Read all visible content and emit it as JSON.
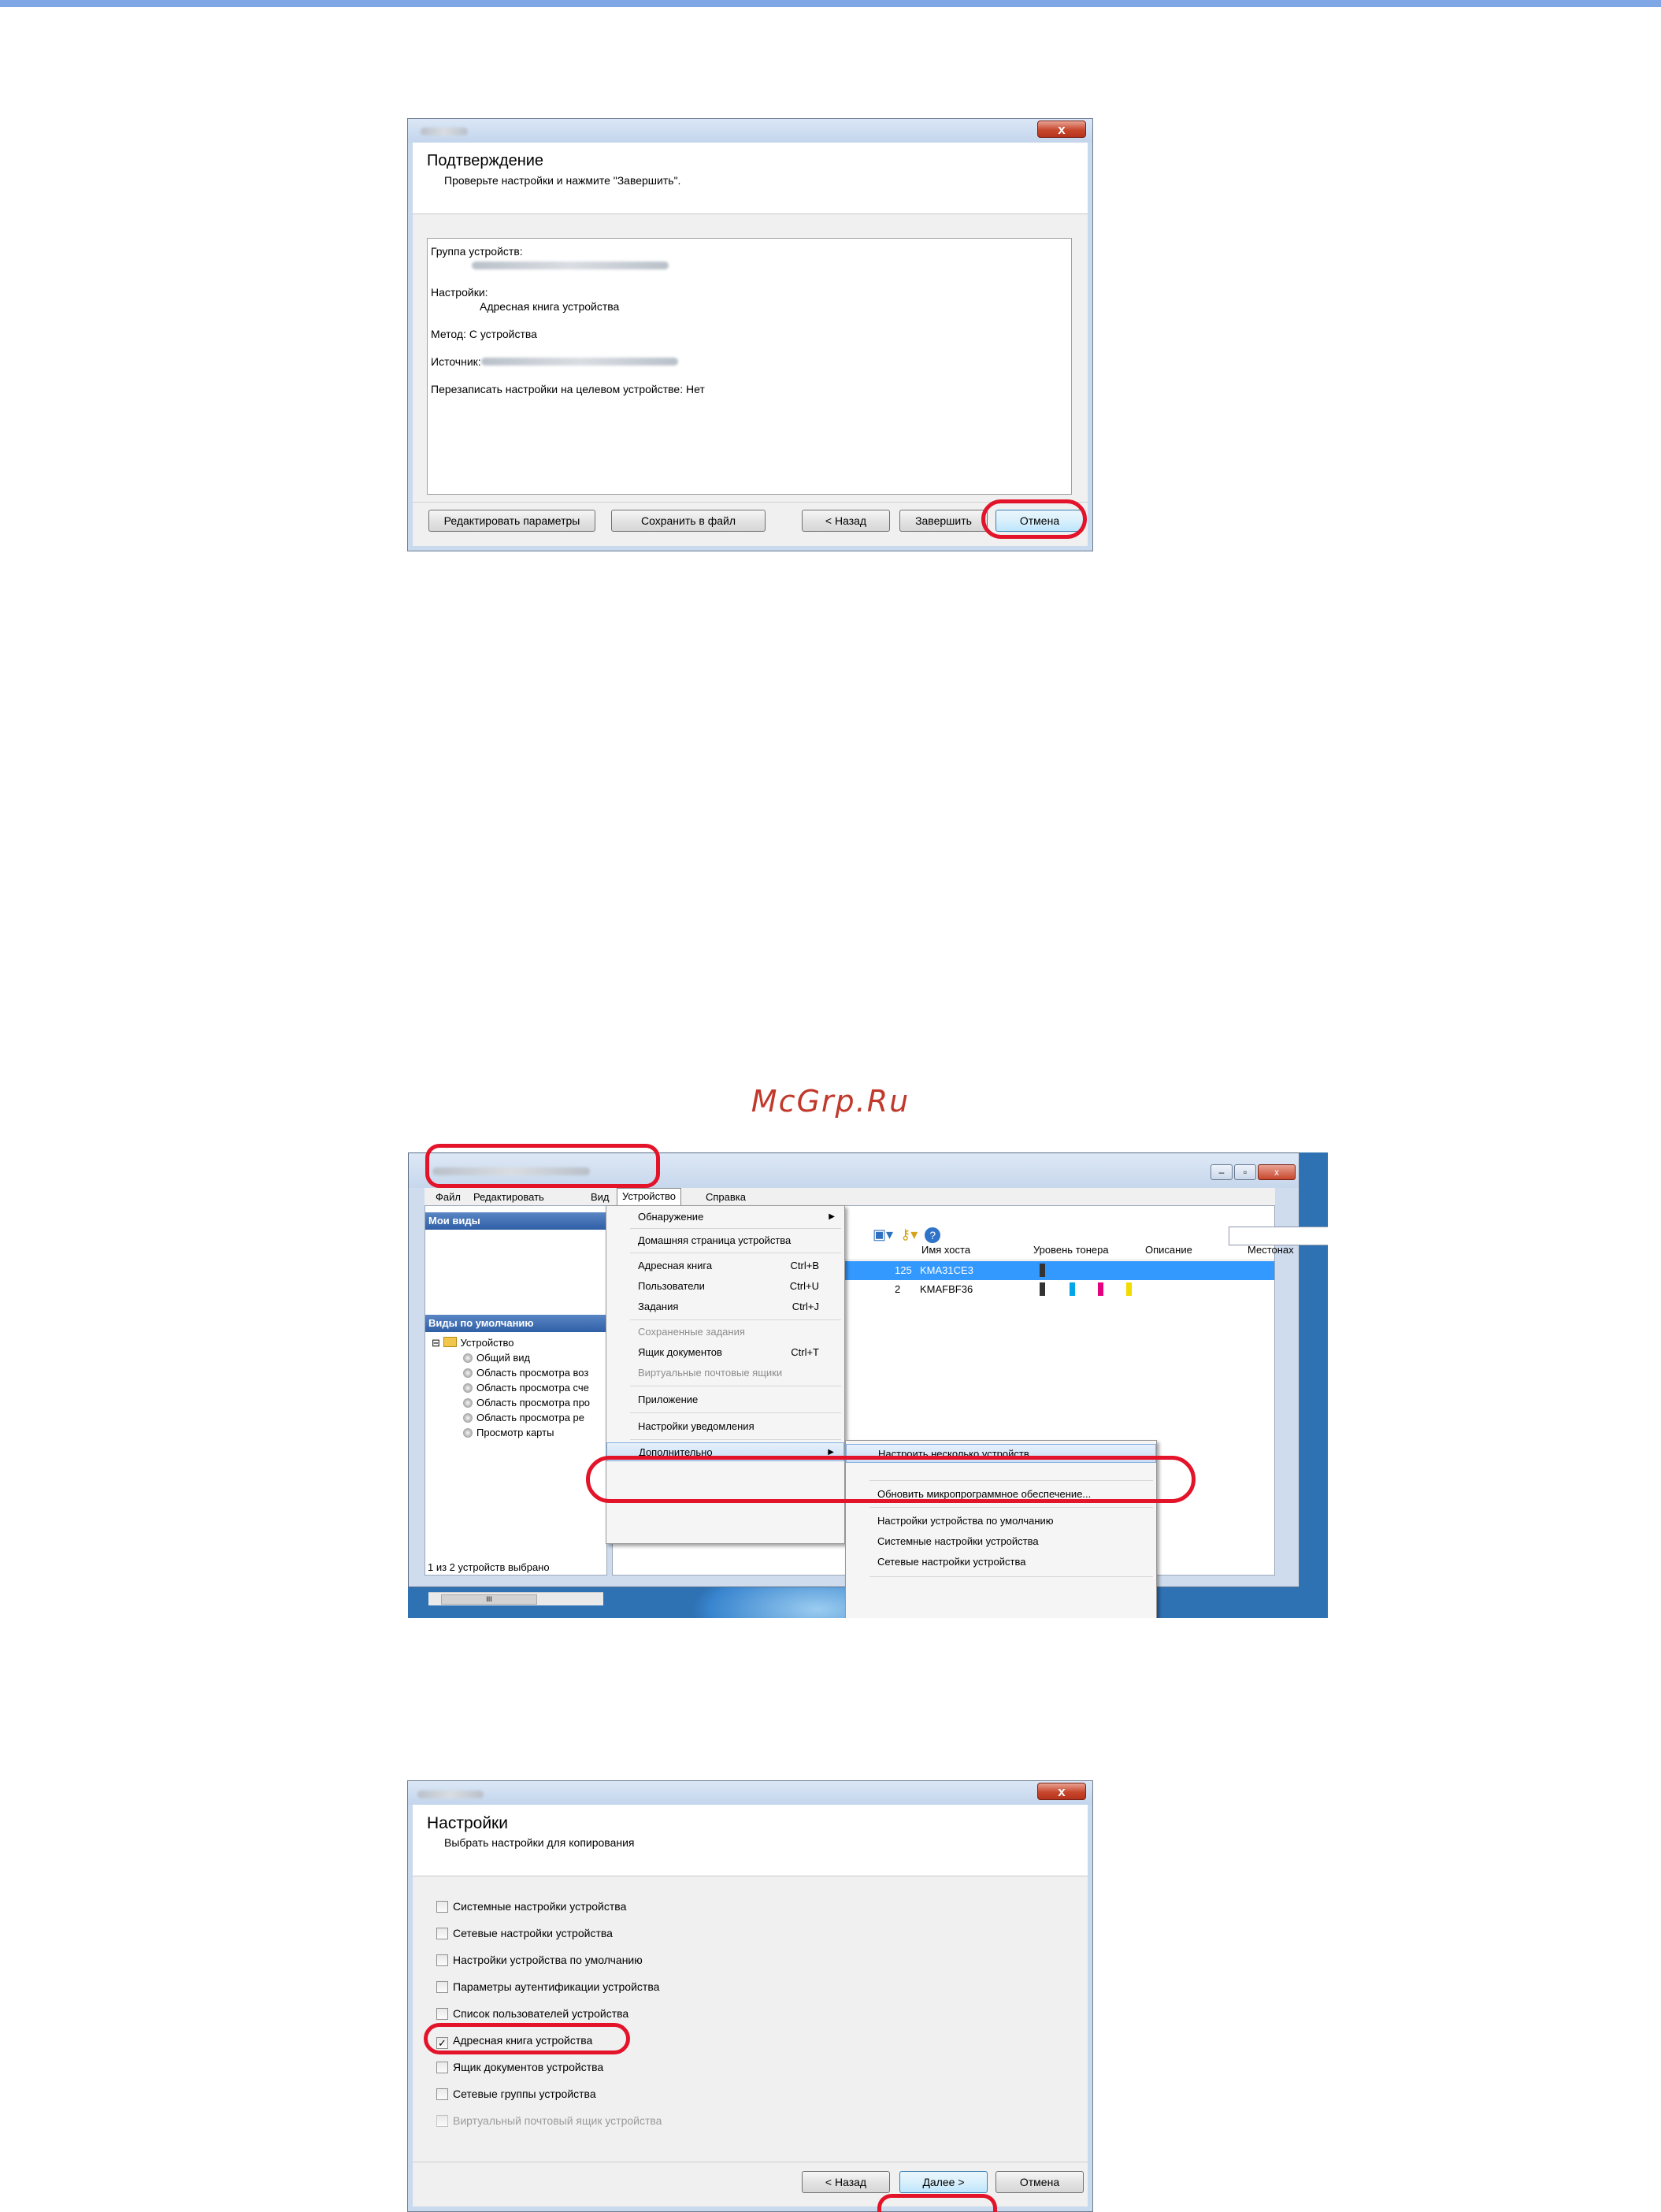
{
  "watermark": "McGrp.Ru",
  "confirm_dialog": {
    "title": "Подтверждение",
    "subtitle": "Проверьте настройки и нажмите \"Завершить\".",
    "close": "x",
    "lines": {
      "group_label": "Группа устройств:",
      "settings_label": "Настройки:",
      "settings_value": "Адресная книга устройства",
      "method": "Метод: С устройства",
      "source_label": "Источник:",
      "overwrite": "Перезаписать настройки на целевом устройстве: Нет"
    },
    "buttons": {
      "edit": "Редактировать параметры",
      "save": "Сохранить в файл",
      "back": "< Назад",
      "finish": "Завершить",
      "cancel": "Отмена"
    }
  },
  "net_viewer": {
    "menu": {
      "file": "Файл",
      "edit": "Редактировать",
      "view": "Вид",
      "device": "Устройство",
      "help": "Справка"
    },
    "left_pane": {
      "my_views": "Мои виды",
      "default_views": "Виды по умолчанию",
      "tree_root": "Устройство",
      "tree_items": [
        "Общий вид",
        "Область просмотра воз",
        "Область просмотра сче",
        "Область просмотра про",
        "Область просмотра ре",
        "Просмотр карты"
      ],
      "scroll_mark": "III"
    },
    "columns": {
      "host": "Имя хоста",
      "toner": "Уровень тонера",
      "desc": "Описание",
      "location": "Местонах"
    },
    "rows": [
      {
        "ip_tail": "125",
        "host": "KMA31CE3"
      },
      {
        "ip_tail": "2",
        "host": "KMAFBF36"
      }
    ],
    "status": "1 из 2 устройств выбрано",
    "device_menu": [
      {
        "label": "Обнаружение",
        "shortcut": ""
      },
      {
        "label": "Домашняя страница устройства",
        "shortcut": ""
      },
      {
        "label": "Адресная книга",
        "shortcut": "Ctrl+B"
      },
      {
        "label": "Пользователи",
        "shortcut": "Ctrl+U"
      },
      {
        "label": "Задания",
        "shortcut": "Ctrl+J"
      },
      {
        "label": "Сохраненные задания",
        "shortcut": ""
      },
      {
        "label": "Ящик документов",
        "shortcut": "Ctrl+T"
      },
      {
        "label": "Виртуальные почтовые ящики",
        "shortcut": ""
      },
      {
        "label": "Приложение",
        "shortcut": ""
      },
      {
        "label": "Настройки уведомления",
        "shortcut": ""
      },
      {
        "label": "Дополнительно",
        "shortcut": ""
      }
    ],
    "sub_menu": [
      "Настроить несколько устройств...",
      "Обновить микропрограммное обеспечение...",
      "Настройки устройства по умолчанию",
      "Системные настройки устройства",
      "Сетевые настройки устройства"
    ]
  },
  "settings_dialog": {
    "title": "Настройки",
    "subtitle": "Выбрать настройки для копирования",
    "close": "x",
    "options": [
      {
        "label": "Системные настройки устройства",
        "checked": false,
        "enabled": true
      },
      {
        "label": "Сетевые настройки устройства",
        "checked": false,
        "enabled": true
      },
      {
        "label": "Настройки устройства по умолчанию",
        "checked": false,
        "enabled": true
      },
      {
        "label": "Параметры аутентификации устройства",
        "checked": false,
        "enabled": true
      },
      {
        "label": "Список пользователей устройства",
        "checked": false,
        "enabled": true
      },
      {
        "label": "Адресная книга устройства",
        "checked": true,
        "enabled": true
      },
      {
        "label": "Ящик документов устройства",
        "checked": false,
        "enabled": true
      },
      {
        "label": "Сетевые группы устройства",
        "checked": false,
        "enabled": true
      },
      {
        "label": "Виртуальный почтовый ящик устройства",
        "checked": false,
        "enabled": false
      }
    ],
    "check_mark": "✓",
    "buttons": {
      "back": "< Назад",
      "next": "Далее >",
      "cancel": "Отмена"
    }
  }
}
